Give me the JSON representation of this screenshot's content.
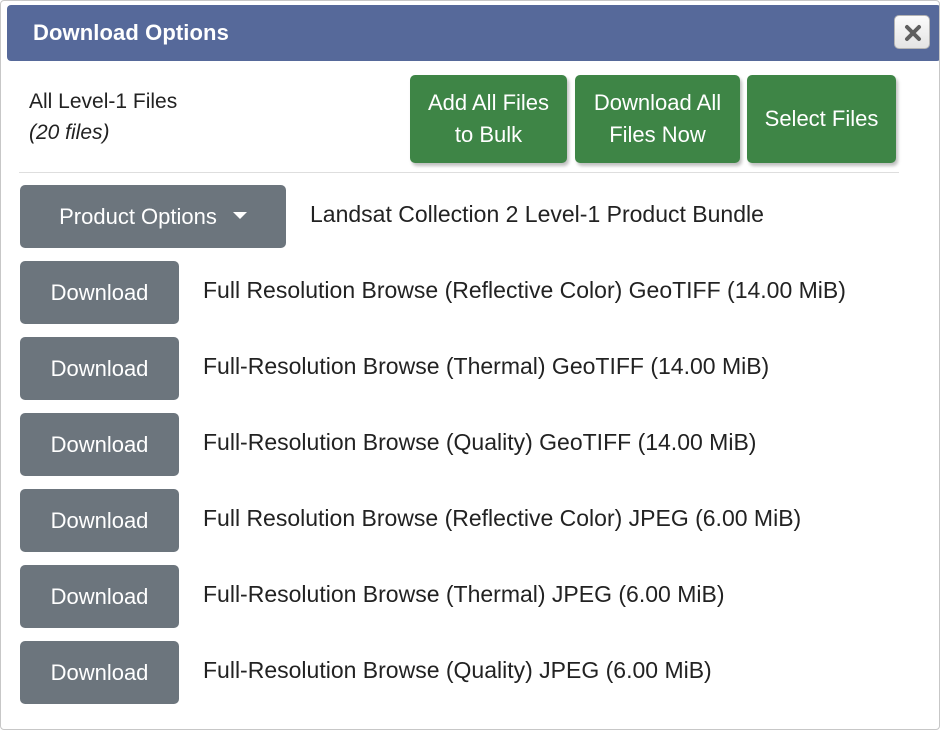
{
  "dialog": {
    "title": "Download Options",
    "close_icon": "close-icon"
  },
  "summary": {
    "title": "All Level-1 Files",
    "count": "(20 files)"
  },
  "actions": {
    "add_all_line1": "Add All Files",
    "add_all_line2": "to Bulk",
    "download_all_line1": "Download All",
    "download_all_line2": "Files Now",
    "select_files": "Select Files"
  },
  "product_options": {
    "label": "Product Options",
    "caret_icon": "caret-down-icon",
    "bundle": "Landsat Collection 2 Level-1 Product Bundle"
  },
  "files": [
    {
      "button": "Download",
      "label": "Full Resolution Browse (Reflective Color) GeoTIFF (14.00 MiB)"
    },
    {
      "button": "Download",
      "label": "Full-Resolution Browse (Thermal) GeoTIFF (14.00 MiB)"
    },
    {
      "button": "Download",
      "label": "Full-Resolution Browse (Quality) GeoTIFF (14.00 MiB)"
    },
    {
      "button": "Download",
      "label": "Full Resolution Browse (Reflective Color) JPEG (6.00 MiB)"
    },
    {
      "button": "Download",
      "label": "Full-Resolution Browse (Thermal) JPEG (6.00 MiB)"
    },
    {
      "button": "Download",
      "label": "Full-Resolution Browse (Quality) JPEG (6.00 MiB)"
    }
  ],
  "colors": {
    "titlebar": "#56699a",
    "primary_green": "#3e8546",
    "secondary_gray": "#6c757d"
  }
}
